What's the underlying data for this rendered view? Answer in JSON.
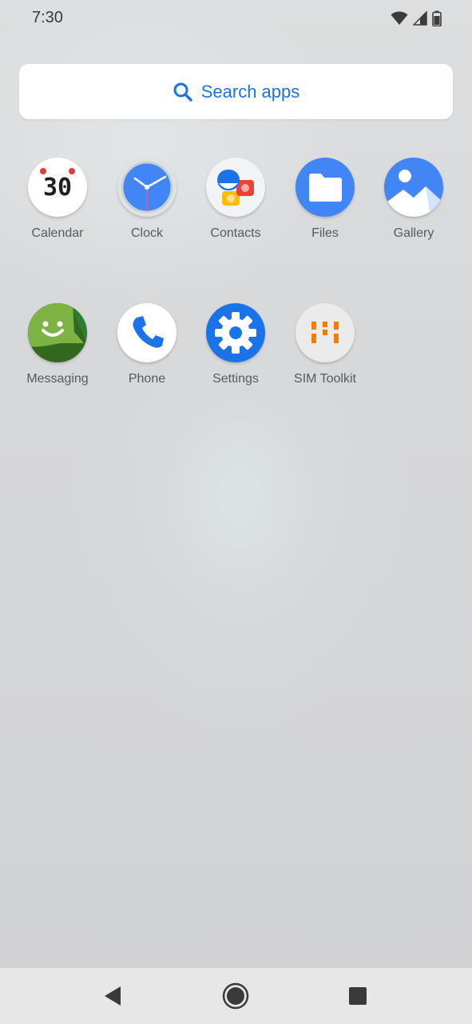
{
  "status_bar": {
    "time": "7:30",
    "icons": [
      "wifi-icon",
      "cell-signal-icon",
      "battery-icon"
    ]
  },
  "search": {
    "placeholder": "Search apps",
    "icon": "search-icon",
    "accent_color": "#1a73e8"
  },
  "apps": [
    {
      "label": "Calendar",
      "icon": "calendar-icon",
      "date_number": "30"
    },
    {
      "label": "Clock",
      "icon": "clock-icon"
    },
    {
      "label": "Contacts",
      "icon": "contacts-icon"
    },
    {
      "label": "Files",
      "icon": "files-icon"
    },
    {
      "label": "Gallery",
      "icon": "gallery-icon"
    },
    {
      "label": "Messaging",
      "icon": "messaging-icon"
    },
    {
      "label": "Phone",
      "icon": "phone-icon"
    },
    {
      "label": "Settings",
      "icon": "settings-icon"
    },
    {
      "label": "SIM Toolkit",
      "icon": "sim-toolkit-icon"
    }
  ],
  "nav_bar": {
    "buttons": [
      "back-icon",
      "home-icon",
      "recents-icon"
    ]
  }
}
